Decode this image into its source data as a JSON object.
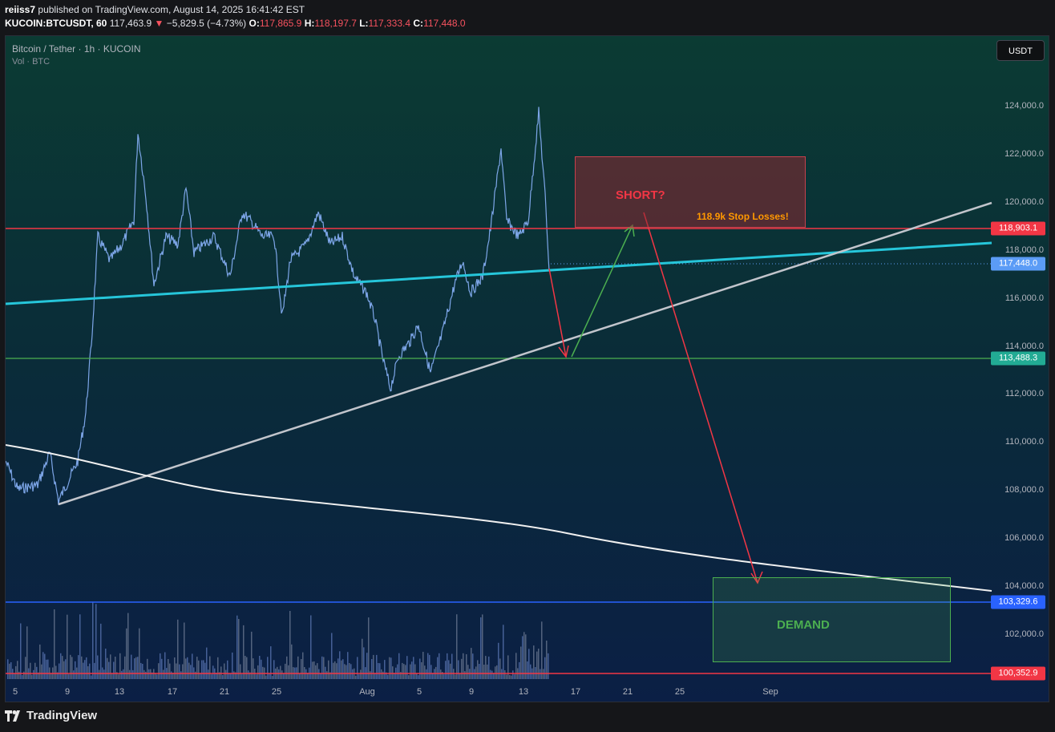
{
  "header": {
    "publisher": "reiiss7",
    "published_text": "published on TradingView.com, August 14, 2025 16:41:42 EST",
    "symbol": "KUCOIN:BTCUSDT, 60",
    "last": "117,463.9",
    "change_arrow": "▼",
    "change": "−5,829.5 (−4.73%)",
    "o_label": "O:",
    "o": "117,865.9",
    "h_label": "H:",
    "h": "118,197.7",
    "l_label": "L:",
    "l": "117,333.4",
    "c_label": "C:",
    "c": "117,448.0"
  },
  "pane": {
    "title": "Bitcoin / Tether · 1h · KUCOIN",
    "subtitle": "Vol · BTC",
    "currency_button": "USDT"
  },
  "y_axis": {
    "ticks": [
      "124,000.0",
      "122,000.0",
      "120,000.0",
      "118,000.0",
      "116,000.0",
      "114,000.0",
      "112,000.0",
      "110,000.0",
      "108,000.0",
      "106,000.0",
      "104,000.0",
      "102,000.0"
    ],
    "price_labels": [
      {
        "text": "118,903.1",
        "color": "#f23645"
      },
      {
        "text": "117,448.0",
        "color": "#5b9cf6"
      },
      {
        "text": "113,488.3",
        "color": "#22ab94"
      },
      {
        "text": "103,329.6",
        "color": "#2962ff"
      },
      {
        "text": "100,352.9",
        "color": "#f23645"
      }
    ]
  },
  "x_axis": {
    "ticks": [
      "5",
      "9",
      "13",
      "17",
      "21",
      "25",
      "Aug",
      "5",
      "9",
      "13",
      "17",
      "21",
      "25",
      "Sep"
    ]
  },
  "annotations": {
    "short_label": "SHORT?",
    "stop_label": "118.9k Stop Losses!",
    "demand_label": "DEMAND"
  },
  "footer": {
    "brand": "TradingView"
  }
}
